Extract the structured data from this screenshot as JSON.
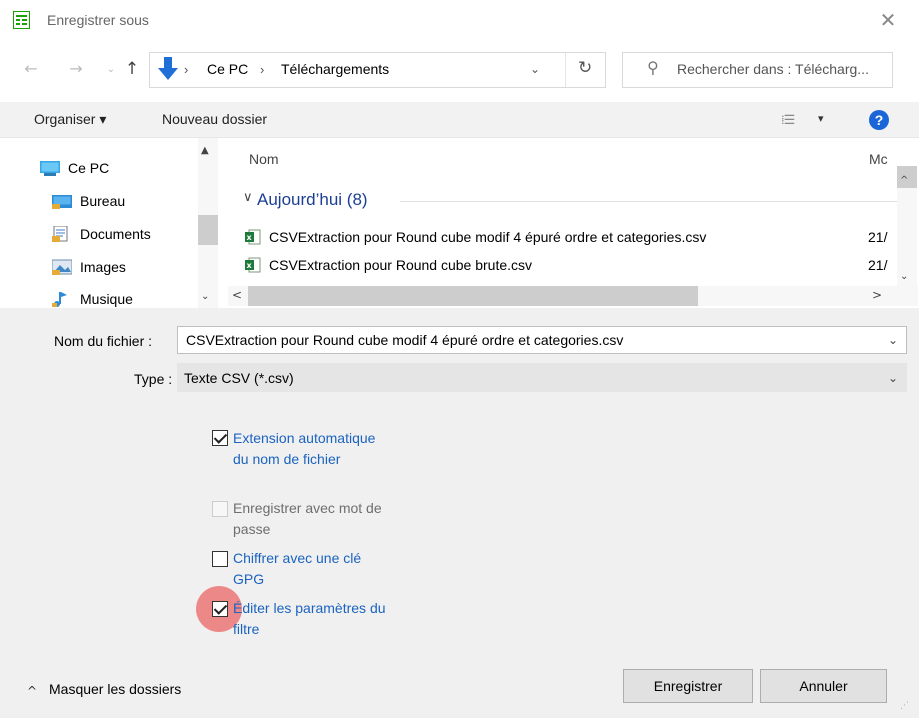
{
  "window": {
    "title": "Enregistrer sous",
    "close_glyph": "✕"
  },
  "nav_buttons": {
    "back": "←",
    "forward": "→",
    "history": "⌄",
    "up": "↑"
  },
  "address": {
    "separator": "›",
    "crumbs": [
      "Ce PC",
      "Téléchargements"
    ],
    "dropdown": "⌄",
    "refresh": "↻"
  },
  "search": {
    "placeholder": "Rechercher dans : Télécharg..."
  },
  "toolbar": {
    "organize": "Organiser ▾",
    "new_folder": "Nouveau dossier",
    "view_icon": "⁞☰",
    "view_dropdown": "▾",
    "help": "?"
  },
  "nav_pane": {
    "items": [
      {
        "label": "Ce PC",
        "icon": "computer-icon"
      },
      {
        "label": "Bureau",
        "icon": "desktop-folder-icon"
      },
      {
        "label": "Documents",
        "icon": "documents-folder-icon"
      },
      {
        "label": "Images",
        "icon": "pictures-folder-icon"
      },
      {
        "label": "Musique",
        "icon": "music-folder-icon"
      }
    ],
    "scroll_up": "▲",
    "scroll_down": "⌄"
  },
  "file_list": {
    "columns": {
      "name": "Nom",
      "modified": "Mc"
    },
    "group": {
      "chevron": "∨",
      "title": "Aujourd’hui (8)"
    },
    "files": [
      {
        "name": "CSVExtraction pour Round cube modif 4 épuré ordre et categories.csv",
        "date": "21/"
      },
      {
        "name": "CSVExtraction pour Round cube brute.csv",
        "date": "21/"
      }
    ],
    "scroll_left": "<",
    "scroll_right": ">",
    "scroll_up": "^",
    "scroll_down": "⌄"
  },
  "form": {
    "filename_label": "Nom du fichier :",
    "filename_value": "CSVExtraction pour Round cube modif 4 épuré ordre et categories.csv",
    "type_label": "Type :",
    "type_value": "Texte CSV (*.csv)",
    "dropdown": "⌄"
  },
  "options": [
    {
      "label": "Extension automatique du nom de fichier",
      "checked": true,
      "disabled": false
    },
    {
      "label": "Enregistrer avec mot de passe",
      "checked": false,
      "disabled": true
    },
    {
      "label": "Chiffrer avec une clé GPG",
      "checked": false,
      "disabled": false
    },
    {
      "label": "Éditer les paramètres du filtre",
      "checked": true,
      "disabled": false
    }
  ],
  "footer": {
    "collapse_chevron": "^",
    "collapse_label": "Masquer les dossiers",
    "save": "Enregistrer",
    "cancel": "Annuler"
  },
  "colors": {
    "accent": "#1b63c0",
    "help_blue": "#1a66d8",
    "group_title": "#1c3f94",
    "click_marker": "#ec6060"
  }
}
